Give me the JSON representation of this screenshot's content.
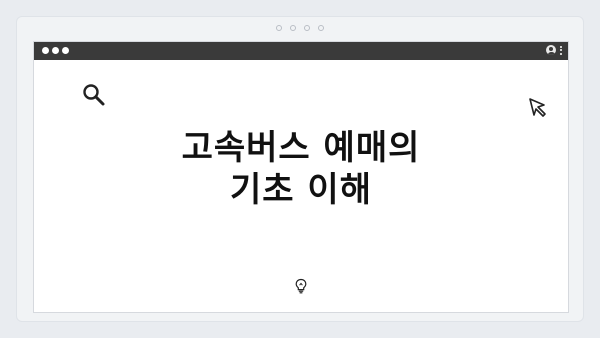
{
  "window": {
    "dots_count": 3
  },
  "slide": {
    "title_line1": "고속버스 예매의",
    "title_line2": "기초 이해"
  },
  "icons": {
    "top_left": "search-icon",
    "top_right": "cursor-arrow-icon",
    "bottom": "lightbulb-icon",
    "titlebar_right": [
      "user-icon",
      "kebab-menu-icon"
    ]
  },
  "colors": {
    "titlebar": "#3a3a3a",
    "background": "#e9ecf0",
    "panel": "#ffffff",
    "text": "#111111"
  }
}
